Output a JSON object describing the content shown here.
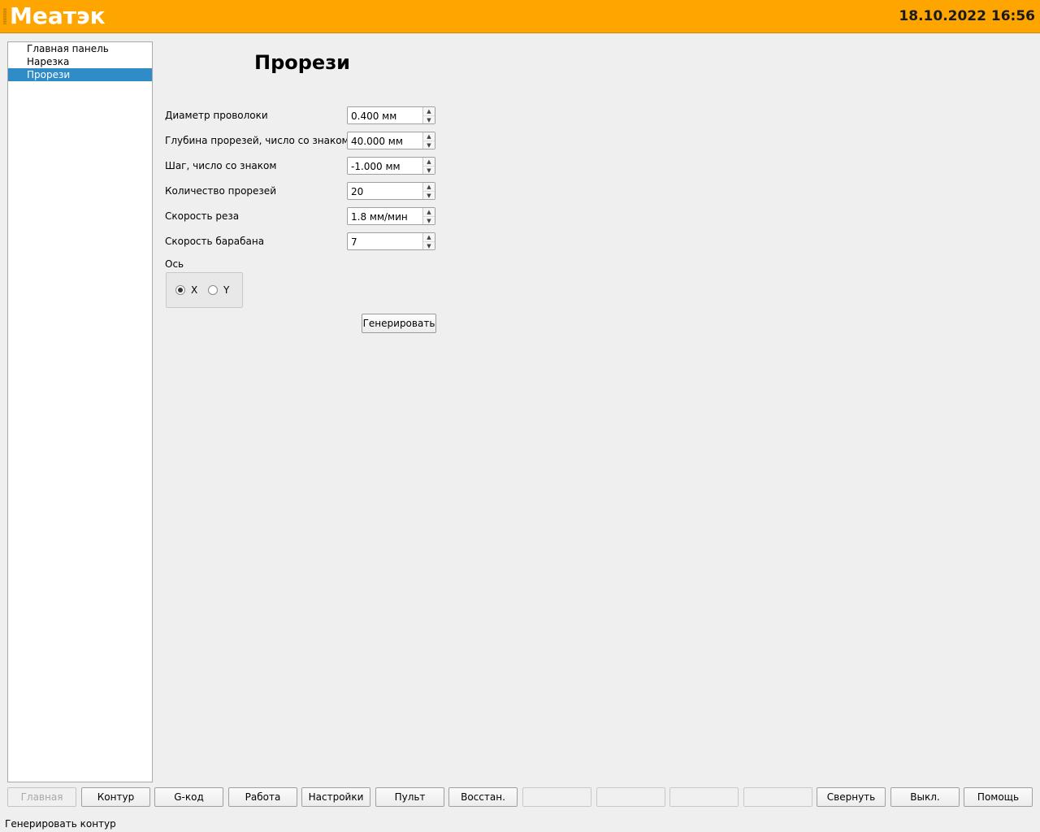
{
  "header": {
    "title": "Meaтэк",
    "datetime": "18.10.2022 16:56",
    "background": "#ffa500"
  },
  "sidebar": {
    "items": [
      {
        "label": "Главная панель",
        "selected": false
      },
      {
        "label": "Нарезка",
        "selected": false
      },
      {
        "label": "Прорези",
        "selected": true
      }
    ],
    "selection_color": "#308cc6"
  },
  "main": {
    "title": "Прорези",
    "fields": [
      {
        "label": "Диаметр проволоки",
        "value": "0.400 мм"
      },
      {
        "label": "Глубина прорезей, число со знаком",
        "value": "40.000 мм"
      },
      {
        "label": "Шаг, число со знаком",
        "value": "-1.000 мм"
      },
      {
        "label": "Количество прорезей",
        "value": "20"
      },
      {
        "label": "Скорость реза",
        "value": "1.8 мм/мин"
      },
      {
        "label": "Скорость барабана",
        "value": "7"
      }
    ],
    "axis": {
      "label": "Ось",
      "options": [
        {
          "label": "X",
          "checked": true
        },
        {
          "label": "Y",
          "checked": false
        }
      ]
    },
    "generate_label": "Генерировать"
  },
  "bottom_bar": {
    "buttons": [
      {
        "label": "Главная",
        "state": "disabled"
      },
      {
        "label": "Контур",
        "state": "normal"
      },
      {
        "label": "G-код",
        "state": "normal"
      },
      {
        "label": "Работа",
        "state": "normal"
      },
      {
        "label": "Настройки",
        "state": "normal"
      },
      {
        "label": "Пульт",
        "state": "normal"
      },
      {
        "label": "Восстан.",
        "state": "normal"
      },
      {
        "label": "",
        "state": "blank"
      },
      {
        "label": "",
        "state": "blank"
      },
      {
        "label": "",
        "state": "blank"
      },
      {
        "label": "",
        "state": "blank"
      },
      {
        "label": "Свернуть",
        "state": "normal"
      },
      {
        "label": "Выкл.",
        "state": "normal"
      },
      {
        "label": "Помощь",
        "state": "normal"
      }
    ]
  },
  "status_bar": {
    "text": "Генерировать контур"
  }
}
